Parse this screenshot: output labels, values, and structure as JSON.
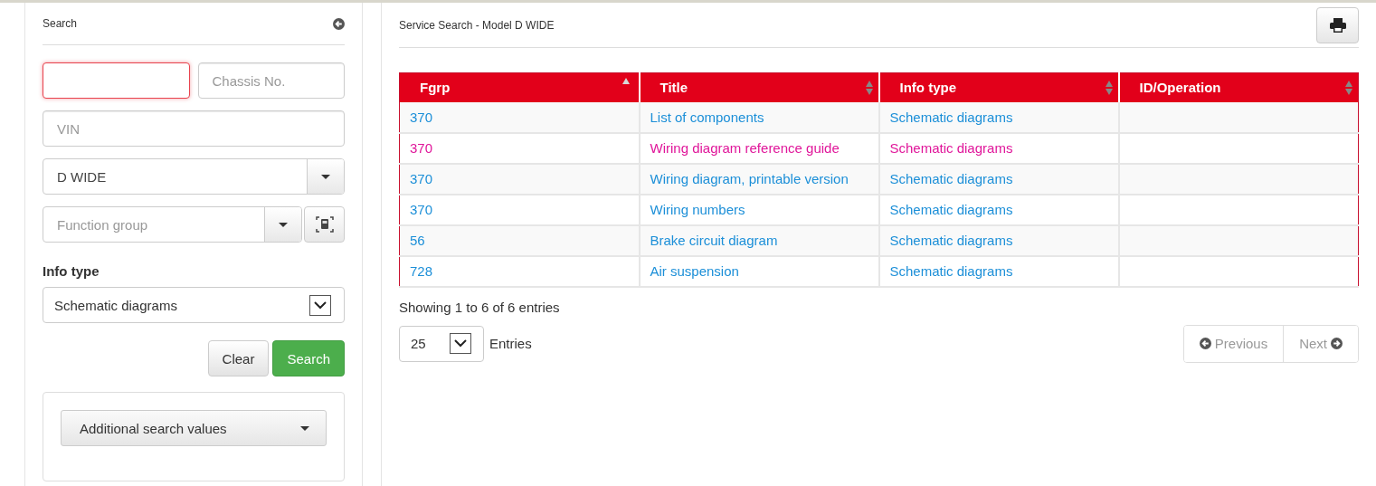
{
  "search_panel": {
    "title": "Search",
    "field_pair": [
      {
        "focused": true
      },
      {
        "placeholder": "Chassis No.",
        "focused": false
      }
    ],
    "fields": [
      {
        "kind": "input",
        "placeholder": "VIN",
        "focused": false
      },
      {
        "kind": "combo",
        "value": "D WIDE"
      },
      {
        "kind": "combo_scan",
        "placeholder": "Function group"
      }
    ],
    "info_type": {
      "label": "Info type",
      "value": "Schematic diagrams"
    },
    "buttons": [
      {
        "label": "Clear",
        "kind": "default"
      },
      {
        "label": "Search",
        "kind": "primary"
      }
    ],
    "additional": {
      "label": "Additional search values"
    }
  },
  "results": {
    "title": "Service Search - Model D WIDE",
    "table": {
      "columns": [
        {
          "label": "Fgrp",
          "sorted": true
        },
        {
          "label": "Title",
          "sorted": false
        },
        {
          "label": "Info type",
          "sorted": false
        },
        {
          "label": "ID/Operation",
          "sorted": false
        }
      ],
      "rows": [
        {
          "cells": [
            "370",
            "List of components",
            "Schematic diagrams"
          ],
          "selected": false
        },
        {
          "cells": [
            "370",
            "Wiring diagram reference guide",
            "Schematic diagrams"
          ],
          "selected": true
        },
        {
          "cells": [
            "370",
            "Wiring diagram, printable version",
            "Schematic diagrams"
          ],
          "selected": false
        },
        {
          "cells": [
            "370",
            "Wiring numbers",
            "Schematic diagrams"
          ],
          "selected": false
        },
        {
          "cells": [
            "56",
            "Brake circuit diagram",
            "Schematic diagrams"
          ],
          "selected": false
        },
        {
          "cells": [
            "728",
            "Air suspension",
            "Schematic diagrams"
          ],
          "selected": false
        }
      ]
    },
    "info": "Showing 1 to 6 of 6 entries",
    "page_size": {
      "value": "25",
      "label": "Entries"
    },
    "pagination": [
      {
        "label": "Previous",
        "kind": "prev",
        "disabled": true
      },
      {
        "label": "Next",
        "kind": "next",
        "disabled": true
      }
    ]
  }
}
